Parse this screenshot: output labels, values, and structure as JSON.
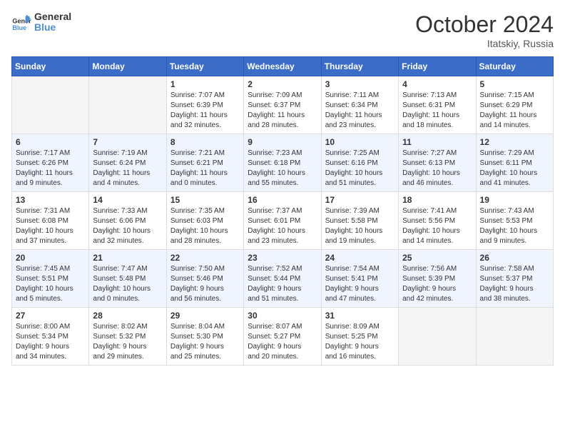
{
  "header": {
    "logo_line1": "General",
    "logo_line2": "Blue",
    "month": "October 2024",
    "location": "Itatskiy, Russia"
  },
  "days_of_week": [
    "Sunday",
    "Monday",
    "Tuesday",
    "Wednesday",
    "Thursday",
    "Friday",
    "Saturday"
  ],
  "weeks": [
    [
      {
        "num": "",
        "info": ""
      },
      {
        "num": "",
        "info": ""
      },
      {
        "num": "1",
        "info": "Sunrise: 7:07 AM\nSunset: 6:39 PM\nDaylight: 11 hours\nand 32 minutes."
      },
      {
        "num": "2",
        "info": "Sunrise: 7:09 AM\nSunset: 6:37 PM\nDaylight: 11 hours\nand 28 minutes."
      },
      {
        "num": "3",
        "info": "Sunrise: 7:11 AM\nSunset: 6:34 PM\nDaylight: 11 hours\nand 23 minutes."
      },
      {
        "num": "4",
        "info": "Sunrise: 7:13 AM\nSunset: 6:31 PM\nDaylight: 11 hours\nand 18 minutes."
      },
      {
        "num": "5",
        "info": "Sunrise: 7:15 AM\nSunset: 6:29 PM\nDaylight: 11 hours\nand 14 minutes."
      }
    ],
    [
      {
        "num": "6",
        "info": "Sunrise: 7:17 AM\nSunset: 6:26 PM\nDaylight: 11 hours\nand 9 minutes."
      },
      {
        "num": "7",
        "info": "Sunrise: 7:19 AM\nSunset: 6:24 PM\nDaylight: 11 hours\nand 4 minutes."
      },
      {
        "num": "8",
        "info": "Sunrise: 7:21 AM\nSunset: 6:21 PM\nDaylight: 11 hours\nand 0 minutes."
      },
      {
        "num": "9",
        "info": "Sunrise: 7:23 AM\nSunset: 6:18 PM\nDaylight: 10 hours\nand 55 minutes."
      },
      {
        "num": "10",
        "info": "Sunrise: 7:25 AM\nSunset: 6:16 PM\nDaylight: 10 hours\nand 51 minutes."
      },
      {
        "num": "11",
        "info": "Sunrise: 7:27 AM\nSunset: 6:13 PM\nDaylight: 10 hours\nand 46 minutes."
      },
      {
        "num": "12",
        "info": "Sunrise: 7:29 AM\nSunset: 6:11 PM\nDaylight: 10 hours\nand 41 minutes."
      }
    ],
    [
      {
        "num": "13",
        "info": "Sunrise: 7:31 AM\nSunset: 6:08 PM\nDaylight: 10 hours\nand 37 minutes."
      },
      {
        "num": "14",
        "info": "Sunrise: 7:33 AM\nSunset: 6:06 PM\nDaylight: 10 hours\nand 32 minutes."
      },
      {
        "num": "15",
        "info": "Sunrise: 7:35 AM\nSunset: 6:03 PM\nDaylight: 10 hours\nand 28 minutes."
      },
      {
        "num": "16",
        "info": "Sunrise: 7:37 AM\nSunset: 6:01 PM\nDaylight: 10 hours\nand 23 minutes."
      },
      {
        "num": "17",
        "info": "Sunrise: 7:39 AM\nSunset: 5:58 PM\nDaylight: 10 hours\nand 19 minutes."
      },
      {
        "num": "18",
        "info": "Sunrise: 7:41 AM\nSunset: 5:56 PM\nDaylight: 10 hours\nand 14 minutes."
      },
      {
        "num": "19",
        "info": "Sunrise: 7:43 AM\nSunset: 5:53 PM\nDaylight: 10 hours\nand 9 minutes."
      }
    ],
    [
      {
        "num": "20",
        "info": "Sunrise: 7:45 AM\nSunset: 5:51 PM\nDaylight: 10 hours\nand 5 minutes."
      },
      {
        "num": "21",
        "info": "Sunrise: 7:47 AM\nSunset: 5:48 PM\nDaylight: 10 hours\nand 0 minutes."
      },
      {
        "num": "22",
        "info": "Sunrise: 7:50 AM\nSunset: 5:46 PM\nDaylight: 9 hours\nand 56 minutes."
      },
      {
        "num": "23",
        "info": "Sunrise: 7:52 AM\nSunset: 5:44 PM\nDaylight: 9 hours\nand 51 minutes."
      },
      {
        "num": "24",
        "info": "Sunrise: 7:54 AM\nSunset: 5:41 PM\nDaylight: 9 hours\nand 47 minutes."
      },
      {
        "num": "25",
        "info": "Sunrise: 7:56 AM\nSunset: 5:39 PM\nDaylight: 9 hours\nand 42 minutes."
      },
      {
        "num": "26",
        "info": "Sunrise: 7:58 AM\nSunset: 5:37 PM\nDaylight: 9 hours\nand 38 minutes."
      }
    ],
    [
      {
        "num": "27",
        "info": "Sunrise: 8:00 AM\nSunset: 5:34 PM\nDaylight: 9 hours\nand 34 minutes."
      },
      {
        "num": "28",
        "info": "Sunrise: 8:02 AM\nSunset: 5:32 PM\nDaylight: 9 hours\nand 29 minutes."
      },
      {
        "num": "29",
        "info": "Sunrise: 8:04 AM\nSunset: 5:30 PM\nDaylight: 9 hours\nand 25 minutes."
      },
      {
        "num": "30",
        "info": "Sunrise: 8:07 AM\nSunset: 5:27 PM\nDaylight: 9 hours\nand 20 minutes."
      },
      {
        "num": "31",
        "info": "Sunrise: 8:09 AM\nSunset: 5:25 PM\nDaylight: 9 hours\nand 16 minutes."
      },
      {
        "num": "",
        "info": ""
      },
      {
        "num": "",
        "info": ""
      }
    ]
  ]
}
